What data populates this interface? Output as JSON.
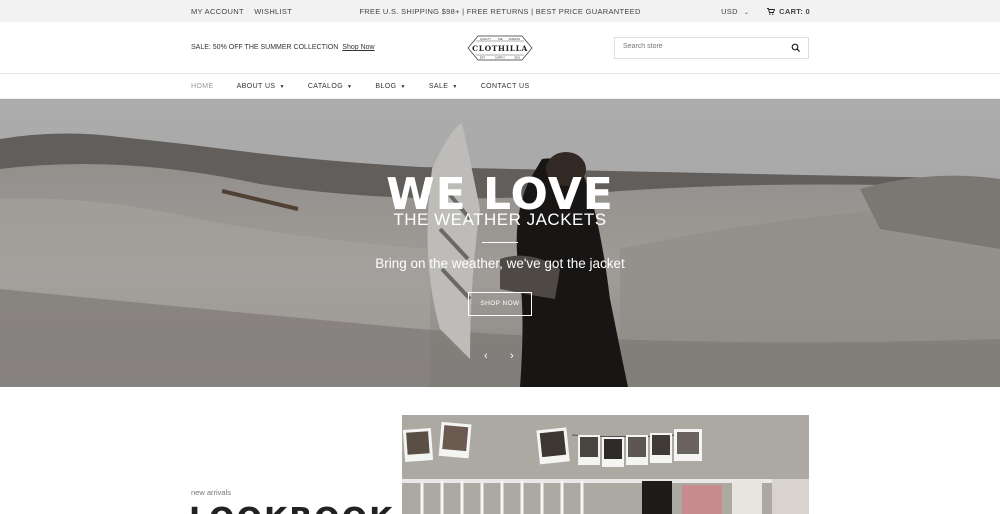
{
  "topbar": {
    "my_account": "MY ACCOUNT",
    "wishlist": "WISHLIST",
    "announcement": "FREE U.S. SHIPPING $98+  |  FREE RETURNS  |  BEST PRICE GUARANTEED",
    "currency": "USD",
    "cart": "CART: 0"
  },
  "header": {
    "promo_text": "SALE: 50% OFF THE SUMMER COLLECTION",
    "promo_link": "Shop Now",
    "logo": {
      "top_left": "QUALITY",
      "top_center": "THE",
      "top_right": "FASHION",
      "name": "CLOTHILLA",
      "bottom_left": "EST",
      "bottom_center": "SUPPLY",
      "bottom_right": "2016"
    },
    "search_placeholder": "Search store"
  },
  "nav": {
    "items": [
      {
        "label": "HOME",
        "dropdown": false,
        "active": true
      },
      {
        "label": "ABOUT US",
        "dropdown": true
      },
      {
        "label": "CATALOG",
        "dropdown": true
      },
      {
        "label": "BLOG",
        "dropdown": true
      },
      {
        "label": "SALE",
        "dropdown": true
      },
      {
        "label": "CONTACT US",
        "dropdown": false
      }
    ]
  },
  "hero": {
    "title": "WE LOVE",
    "subtitle": "THE WEATHER JACKETS",
    "tagline": "Bring on the weather, we've got the jacket",
    "button": "SHOP NOW"
  },
  "lookbook": {
    "eyebrow": "new arrivals",
    "heading": "LOOKBOOK"
  },
  "icons": {
    "cart": "cart-icon",
    "search": "search-icon",
    "prev": "chevron-left-icon",
    "next": "chevron-right-icon"
  }
}
